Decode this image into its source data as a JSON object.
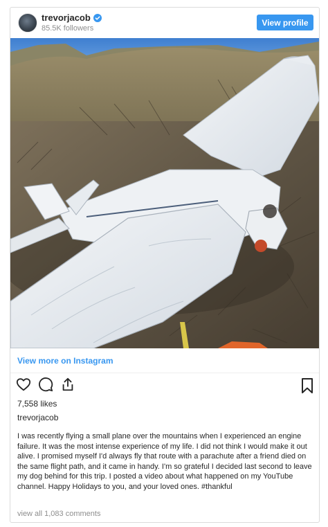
{
  "header": {
    "username": "trevorjacob",
    "followers": "85.5K followers",
    "view_profile_label": "View profile"
  },
  "post": {
    "view_more_label": "View more on Instagram",
    "likes": "7,558 likes",
    "author": "trevorjacob",
    "caption": "I was recently flying a small plane over the mountains when I experienced an engine failure. It was the most intense experience of my life. I did not think I would make it out alive. I promised myself I'd always fly that route with a parachute after a friend died on the same flight path, and it came in handy. I'm so grateful I decided last second to leave my dog behind for this trip. I posted a video about what happened on my YouTube channel. Happy Holidays to you, and your loved ones. #thankful",
    "comments_link": "view all 1,083 comments"
  },
  "icons": {
    "verified": "verified-badge-icon",
    "like": "heart-icon",
    "comment": "comment-bubble-icon",
    "share": "share-icon",
    "save": "bookmark-icon"
  },
  "colors": {
    "accent": "#3897f0",
    "text": "#262626",
    "muted": "#8e8e8e",
    "border": "#dbdbdb"
  }
}
